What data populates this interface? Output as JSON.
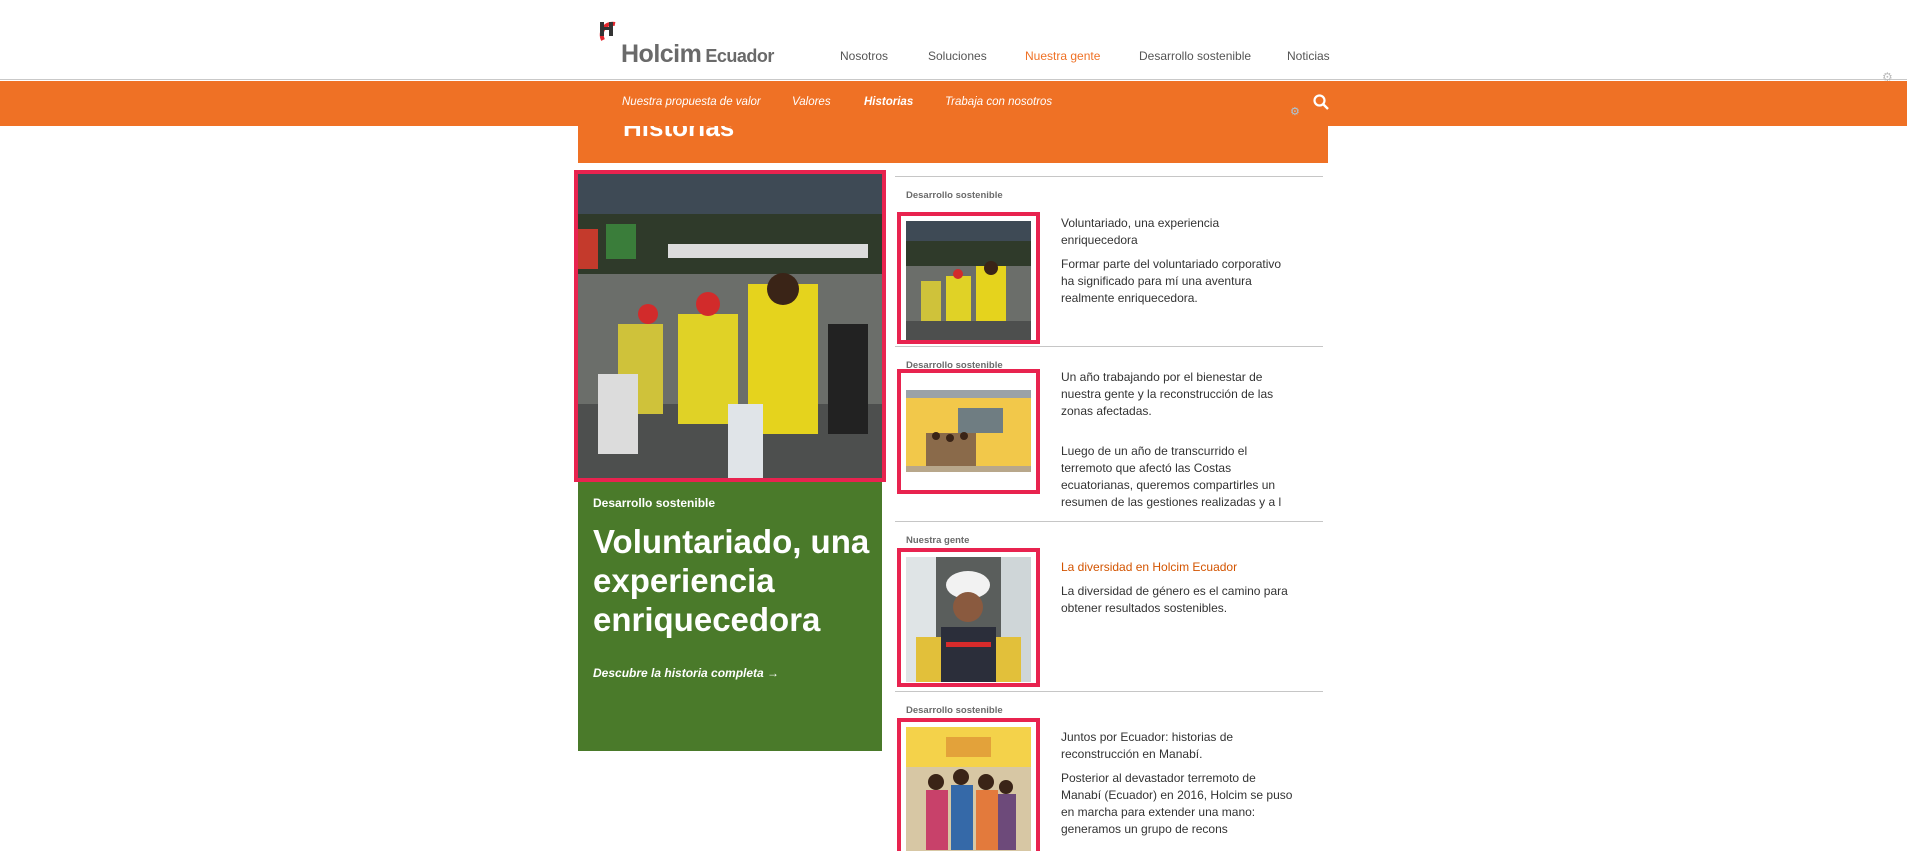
{
  "header": {
    "logo_main": "Holcim",
    "logo_sub": "Ecuador",
    "nav": [
      {
        "label": "Nosotros",
        "active": false
      },
      {
        "label": "Soluciones",
        "active": false
      },
      {
        "label": "Nuestra gente",
        "active": true
      },
      {
        "label": "Desarrollo sostenible",
        "active": false
      },
      {
        "label": "Noticias",
        "active": false
      }
    ]
  },
  "subnav": {
    "items": [
      {
        "label": "Nuestra propuesta de valor",
        "active": false
      },
      {
        "label": "Valores",
        "active": false
      },
      {
        "label": "Historias",
        "active": true
      },
      {
        "label": "Trabaja con nosotros",
        "active": false
      }
    ],
    "search_icon": "search-icon"
  },
  "page_title": "Historias",
  "feature": {
    "category": "Desarrollo sostenible",
    "title": "Voluntariado, una experiencia enriquecedora",
    "link": "Descubre la historia completa →"
  },
  "stories": [
    {
      "category": "Desarrollo sostenible",
      "title": "Voluntariado, una experiencia enriquecedora",
      "description": "Formar parte del voluntariado corporativo ha significado para mí una aventura realmente enriquecedora."
    },
    {
      "category": "Desarrollo sostenible",
      "title": "Un año trabajando por el bienestar de nuestra gente y la reconstrucción de las zonas afectadas.",
      "description": "Luego de un año de transcurrido el terremoto que afectó las Costas ecuatorianas, queremos compartirles un resumen de las gestiones realizadas y a l"
    },
    {
      "category": "Nuestra gente",
      "title": "La diversidad en Holcim Ecuador",
      "description": "La diversidad de género es el camino para obtener resultados sostenibles."
    },
    {
      "category": "Desarrollo sostenible",
      "title": "Juntos por Ecuador: historias de reconstrucción en Manabí.",
      "description": "Posterior al devastador terremoto de Manabí (Ecuador) en 2016, Holcim se puso en marcha para extender una mano: generamos un grupo de recons"
    }
  ],
  "colors": {
    "brand_orange": "#ef7125",
    "feature_green": "#4a7a2a",
    "highlight_red": "#e8234f"
  }
}
